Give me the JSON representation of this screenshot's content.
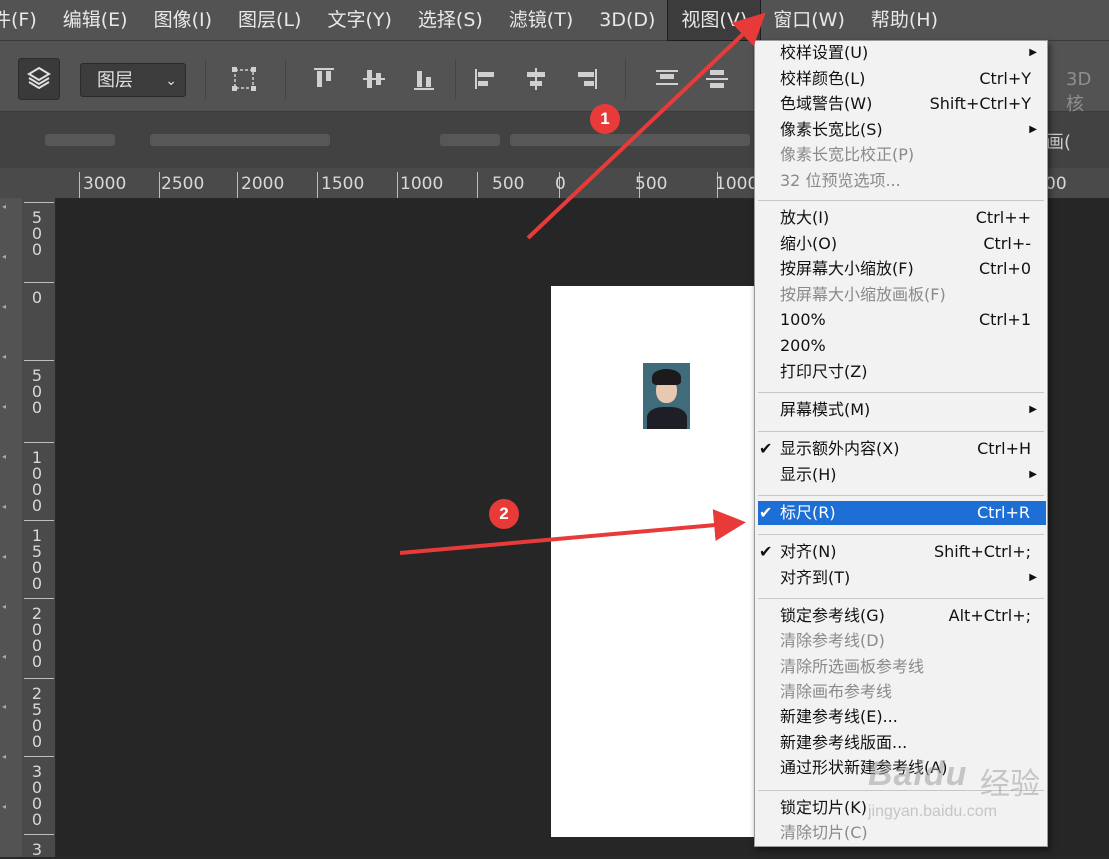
{
  "menubar": {
    "items": [
      "件(F)",
      "编辑(E)",
      "图像(I)",
      "图层(L)",
      "文字(Y)",
      "选择(S)",
      "滤镜(T)",
      "3D(D)",
      "视图(V)",
      "窗口(W)",
      "帮助(H)"
    ]
  },
  "options": {
    "select_value": "图层",
    "threed_label": "3D 核"
  },
  "tabbar": {
    "visible_text": "画("
  },
  "ruler": {
    "h_labels": [
      "3000",
      "2500",
      "2000",
      "1500",
      "1000",
      "500",
      "0",
      "500",
      "1000",
      "00"
    ],
    "v_labels": [
      [
        "5",
        "0",
        "0"
      ],
      [
        "0"
      ],
      [
        "5",
        "0",
        "0"
      ],
      [
        "1",
        "0",
        "0",
        "0"
      ],
      [
        "1",
        "5",
        "0",
        "0"
      ],
      [
        "2",
        "0",
        "0",
        "0"
      ],
      [
        "2",
        "5",
        "0",
        "0"
      ],
      [
        "3",
        "0",
        "0",
        "0"
      ],
      [
        "3"
      ]
    ]
  },
  "view_menu": {
    "groups": [
      [
        {
          "label": "校样设置(U)",
          "submenu": true
        },
        {
          "label": "校样颜色(L)",
          "shortcut": "Ctrl+Y"
        },
        {
          "label": "色域警告(W)",
          "shortcut": "Shift+Ctrl+Y"
        },
        {
          "label": "像素长宽比(S)",
          "submenu": true
        },
        {
          "label": "像素长宽比校正(P)",
          "disabled": true
        },
        {
          "label": "32 位预览选项...",
          "disabled": true
        }
      ],
      [
        {
          "label": "放大(I)",
          "shortcut": "Ctrl++"
        },
        {
          "label": "缩小(O)",
          "shortcut": "Ctrl+-"
        },
        {
          "label": "按屏幕大小缩放(F)",
          "shortcut": "Ctrl+0"
        },
        {
          "label": "按屏幕大小缩放画板(F)",
          "disabled": true
        },
        {
          "label": "100%",
          "shortcut": "Ctrl+1"
        },
        {
          "label": "200%"
        },
        {
          "label": "打印尺寸(Z)"
        }
      ],
      [
        {
          "label": "屏幕模式(M)",
          "submenu": true
        }
      ],
      [
        {
          "label": "显示额外内容(X)",
          "shortcut": "Ctrl+H",
          "checked": true
        },
        {
          "label": "显示(H)",
          "submenu": true
        }
      ],
      [
        {
          "label": "标尺(R)",
          "shortcut": "Ctrl+R",
          "checked": true,
          "selected": true
        }
      ],
      [
        {
          "label": "对齐(N)",
          "shortcut": "Shift+Ctrl+;",
          "checked": true
        },
        {
          "label": "对齐到(T)",
          "submenu": true
        }
      ],
      [
        {
          "label": "锁定参考线(G)",
          "shortcut": "Alt+Ctrl+;"
        },
        {
          "label": "清除参考线(D)",
          "disabled": true
        },
        {
          "label": "清除所选画板参考线",
          "disabled": true
        },
        {
          "label": "清除画布参考线",
          "disabled": true
        },
        {
          "label": "新建参考线(E)..."
        },
        {
          "label": "新建参考线版面..."
        },
        {
          "label": "通过形状新建参考线(A)"
        }
      ],
      [
        {
          "label": "锁定切片(K)"
        },
        {
          "label": "清除切片(C)",
          "disabled": true
        }
      ]
    ]
  },
  "annotations": {
    "badge1": "1",
    "badge2": "2",
    "arrow_color": "#e93a3a"
  },
  "watermark": {
    "main": "Baidu",
    "cn": "经验",
    "url": "jingyan.baidu.com"
  },
  "colors": {
    "menubar_bg": "#535353",
    "selected_item": "#1e6fd5",
    "canvas_bg": "#262626"
  }
}
